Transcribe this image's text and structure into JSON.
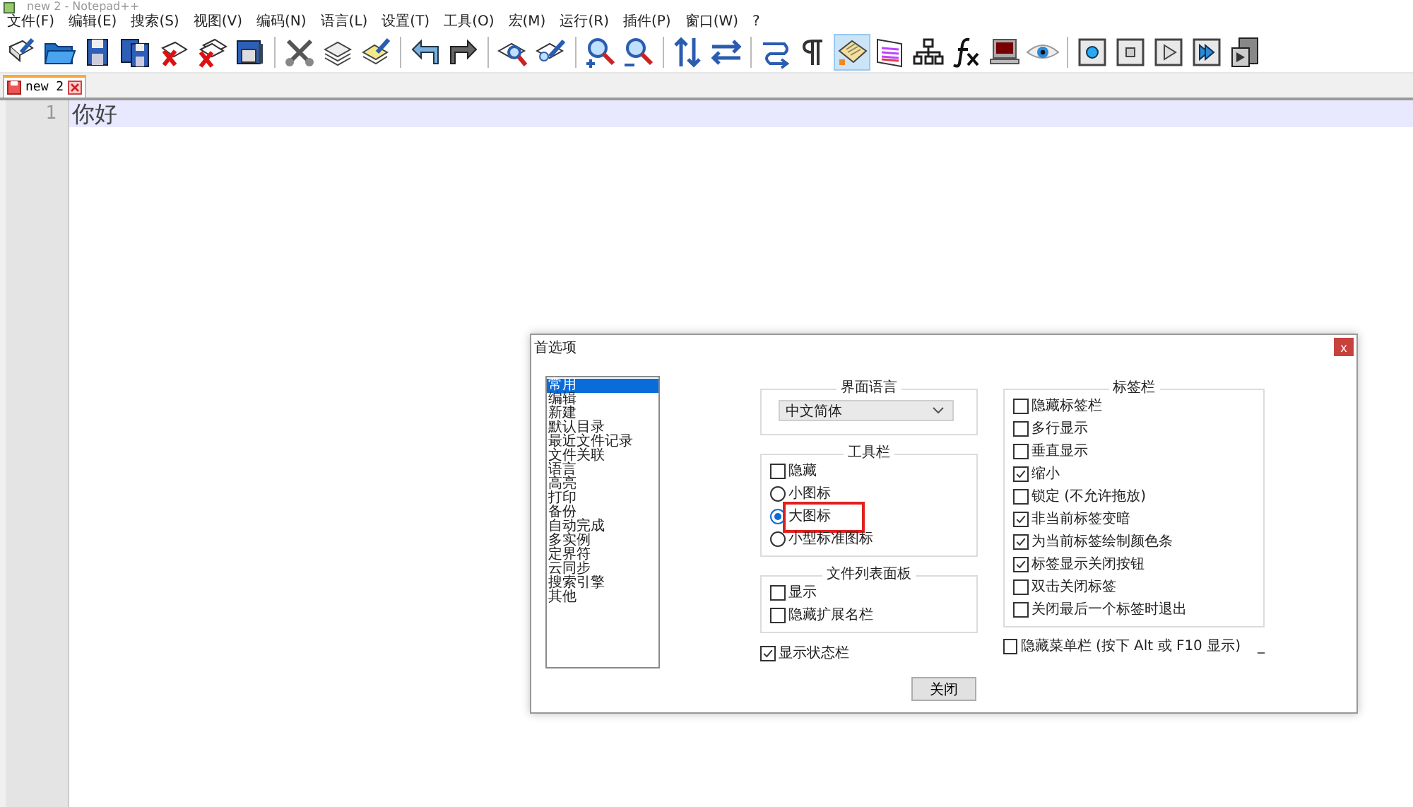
{
  "window": {
    "title": "new 2 - Notepad++"
  },
  "menu": [
    "文件(F)",
    "编辑(E)",
    "搜索(S)",
    "视图(V)",
    "编码(N)",
    "语言(L)",
    "设置(T)",
    "工具(O)",
    "宏(M)",
    "运行(R)",
    "插件(P)",
    "窗口(W)",
    "?"
  ],
  "toolbar": [
    {
      "kind": "button",
      "pressed": false
    },
    {
      "kind": "button",
      "pressed": false
    },
    {
      "kind": "button",
      "pressed": false
    },
    {
      "kind": "button",
      "pressed": false
    },
    {
      "kind": "button",
      "pressed": false
    },
    {
      "kind": "button",
      "pressed": false
    },
    {
      "kind": "button",
      "pressed": false
    },
    {
      "kind": "separator"
    },
    {
      "kind": "button",
      "pressed": false
    },
    {
      "kind": "button",
      "pressed": false
    },
    {
      "kind": "button",
      "pressed": false
    },
    {
      "kind": "separator"
    },
    {
      "kind": "button",
      "pressed": false
    },
    {
      "kind": "button",
      "pressed": false
    },
    {
      "kind": "separator"
    },
    {
      "kind": "button",
      "pressed": false
    },
    {
      "kind": "button",
      "pressed": false
    },
    {
      "kind": "separator"
    },
    {
      "kind": "button",
      "pressed": false
    },
    {
      "kind": "button",
      "pressed": false
    },
    {
      "kind": "separator"
    },
    {
      "kind": "button",
      "pressed": false
    },
    {
      "kind": "button",
      "pressed": false
    },
    {
      "kind": "separator"
    },
    {
      "kind": "button",
      "pressed": false
    },
    {
      "kind": "button",
      "pressed": false
    },
    {
      "kind": "button",
      "pressed": true
    },
    {
      "kind": "button",
      "pressed": false
    },
    {
      "kind": "button",
      "pressed": false
    },
    {
      "kind": "button",
      "pressed": false
    },
    {
      "kind": "button",
      "pressed": false
    },
    {
      "kind": "button",
      "pressed": false
    },
    {
      "kind": "separator"
    },
    {
      "kind": "button",
      "pressed": false
    },
    {
      "kind": "button",
      "pressed": false
    },
    {
      "kind": "button",
      "pressed": false
    },
    {
      "kind": "button",
      "pressed": false
    },
    {
      "kind": "button",
      "pressed": false
    }
  ],
  "tabs": [
    {
      "label": "new 2",
      "selected": true
    }
  ],
  "editor": {
    "lines": [
      {
        "number": "1",
        "text": "你好",
        "current": true
      }
    ]
  },
  "dialog": {
    "title": "首选项",
    "close": "x",
    "categories": [
      {
        "label": "常用",
        "selected": true
      },
      {
        "label": "编辑",
        "selected": false
      },
      {
        "label": "新建",
        "selected": false
      },
      {
        "label": "默认目录",
        "selected": false
      },
      {
        "label": "最近文件记录",
        "selected": false
      },
      {
        "label": "文件关联",
        "selected": false
      },
      {
        "label": "语言",
        "selected": false
      },
      {
        "label": "高亮",
        "selected": false
      },
      {
        "label": "打印",
        "selected": false
      },
      {
        "label": "备份",
        "selected": false
      },
      {
        "label": "自动完成",
        "selected": false
      },
      {
        "label": "多实例",
        "selected": false
      },
      {
        "label": "定界符",
        "selected": false
      },
      {
        "label": "云同步",
        "selected": false
      },
      {
        "label": "搜索引擎",
        "selected": false
      },
      {
        "label": "其他",
        "selected": false
      }
    ],
    "language_group": {
      "title": "界面语言",
      "value": "中文简体"
    },
    "toolbar_group": {
      "title": "工具栏",
      "options": [
        {
          "kind": "checkbox",
          "label": "隐藏",
          "checked": false,
          "highlighted": false
        },
        {
          "kind": "radio",
          "label": "小图标",
          "selected": false,
          "highlighted": false
        },
        {
          "kind": "radio",
          "label": "大图标",
          "selected": true,
          "highlighted": true
        },
        {
          "kind": "radio",
          "label": "小型标准图标",
          "selected": false,
          "highlighted": false
        }
      ]
    },
    "file_list_group": {
      "title": "文件列表面板",
      "options": [
        {
          "label": "显示",
          "checked": false
        },
        {
          "label": "隐藏扩展名栏",
          "checked": false
        }
      ]
    },
    "status_bar_option": {
      "label": "显示状态栏",
      "checked": true
    },
    "tab_bar_group": {
      "title": "标签栏",
      "options": [
        {
          "label": "隐藏标签栏",
          "checked": false
        },
        {
          "label": "多行显示",
          "checked": false
        },
        {
          "label": "垂直显示",
          "checked": false
        },
        {
          "label": "缩小",
          "checked": true
        },
        {
          "label": "锁定 (不允许拖放)",
          "checked": false
        },
        {
          "label": "非当前标签变暗",
          "checked": true
        },
        {
          "label": "为当前标签绘制颜色条",
          "checked": true
        },
        {
          "label": "标签显示关闭按钮",
          "checked": true
        },
        {
          "label": "双击关闭标签",
          "checked": false
        },
        {
          "label": "关闭最后一个标签时退出",
          "checked": false
        }
      ]
    },
    "menu_bar_option": {
      "label": "隐藏菜单栏 (按下 Alt 或 F10 显示)",
      "checked": false,
      "suffix": "_"
    },
    "buttons": [
      "关闭"
    ]
  }
}
